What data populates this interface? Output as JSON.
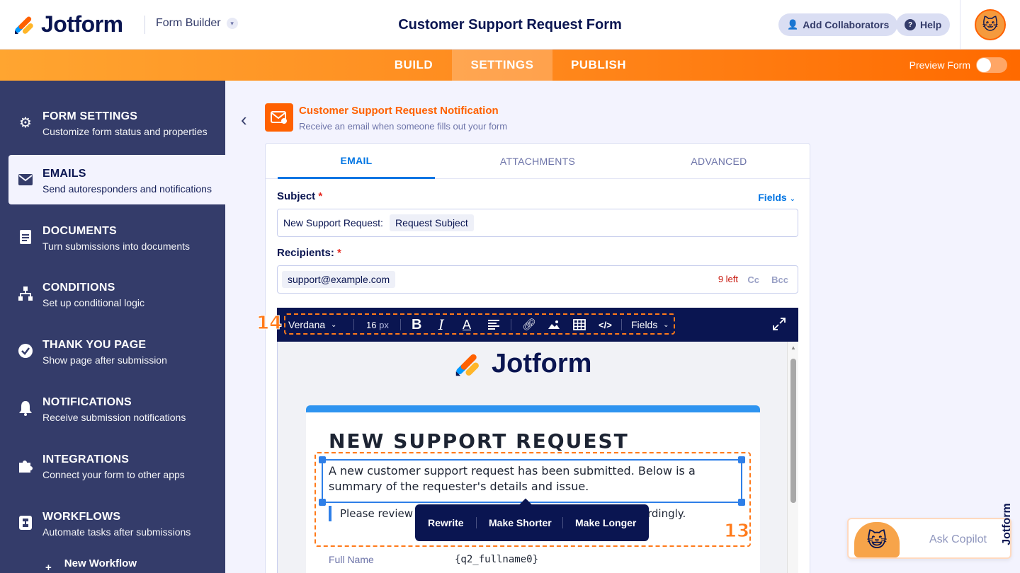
{
  "brand": {
    "name": "Jotform",
    "colors": {
      "orange": "#ff6100",
      "blue": "#0075e3",
      "navy": "#0a1551",
      "sidebar": "#343c6a"
    }
  },
  "header": {
    "mode_label": "Form Builder",
    "form_title": "Customer Support Request Form",
    "add_collaborators": "Add Collaborators",
    "help": "Help"
  },
  "nav": {
    "tabs": [
      {
        "label": "BUILD",
        "active": false
      },
      {
        "label": "SETTINGS",
        "active": true
      },
      {
        "label": "PUBLISH",
        "active": false
      }
    ],
    "preview_label": "Preview Form",
    "preview_on": false
  },
  "sidebar": {
    "items": [
      {
        "title": "FORM SETTINGS",
        "subtitle": "Customize form status and properties",
        "icon": "gear-icon"
      },
      {
        "title": "EMAILS",
        "subtitle": "Send autoresponders and notifications",
        "icon": "envelope-icon",
        "active": true
      },
      {
        "title": "DOCUMENTS",
        "subtitle": "Turn submissions into documents",
        "icon": "document-icon"
      },
      {
        "title": "CONDITIONS",
        "subtitle": "Set up conditional logic",
        "icon": "hierarchy-icon"
      },
      {
        "title": "THANK YOU PAGE",
        "subtitle": "Show page after submission",
        "icon": "check-circle-icon"
      },
      {
        "title": "NOTIFICATIONS",
        "subtitle": "Receive submission notifications",
        "icon": "bell-icon"
      },
      {
        "title": "INTEGRATIONS",
        "subtitle": "Connect your form to other apps",
        "icon": "puzzle-icon"
      },
      {
        "title": "WORKFLOWS",
        "subtitle": "Automate tasks after submissions",
        "icon": "workflow-icon"
      }
    ],
    "new_workflow": "New Workflow"
  },
  "notification": {
    "title": "Customer Support Request Notification",
    "subtitle": "Receive an email when someone fills out your form"
  },
  "email_tabs": [
    {
      "label": "EMAIL",
      "active": true
    },
    {
      "label": "ATTACHMENTS",
      "active": false
    },
    {
      "label": "ADVANCED",
      "active": false
    }
  ],
  "subject": {
    "label": "Subject",
    "fields_link": "Fields",
    "prefix": "New Support Request:",
    "chip": "Request Subject"
  },
  "recipients": {
    "label": "Recipients:",
    "email": "support@example.com",
    "left": "9 left",
    "cc": "Cc",
    "bcc": "Bcc"
  },
  "toolbar": {
    "font": "Verdana",
    "size": "16",
    "size_unit": "px",
    "fields": "Fields"
  },
  "annotations": {
    "toolbar": "14",
    "body": "13"
  },
  "email_body": {
    "heading": "NEW SUPPORT REQUEST",
    "paragraph": "A new customer support request has been submitted. Below is a summary of the requester's details and issue.",
    "quote_start": "Please review",
    "quote_end": "rdingly.",
    "ai_actions": [
      "Rewrite",
      "Make Shorter",
      "Make Longer"
    ],
    "field_label": "Full Name",
    "field_value": "{q2_fullname0}"
  },
  "copilot": {
    "label": "Ask Copilot"
  }
}
